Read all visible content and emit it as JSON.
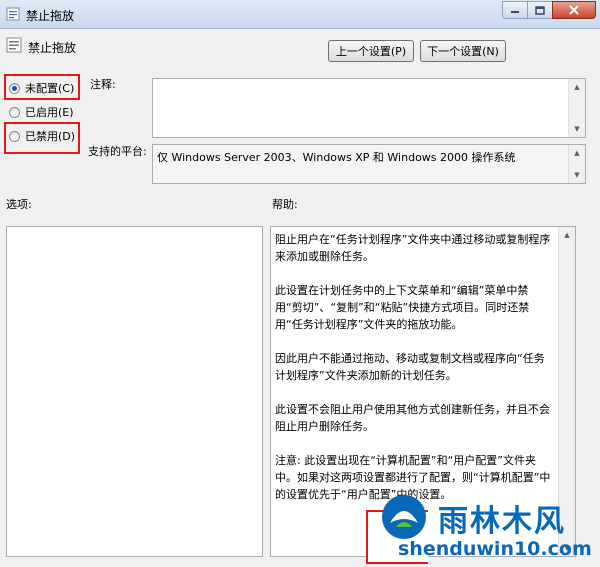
{
  "window": {
    "title": "禁止拖放",
    "controls": [
      "minimize-icon",
      "maximize-icon",
      "close-icon"
    ]
  },
  "header": {
    "policy_name": "禁止拖放",
    "prev_button": "上一个设置(P)",
    "next_button": "下一个设置(N)"
  },
  "state": {
    "options": [
      {
        "label": "未配置(C)",
        "checked": true
      },
      {
        "label": "已启用(E)",
        "checked": false
      },
      {
        "label": "已禁用(D)",
        "checked": false
      }
    ]
  },
  "comment": {
    "label": "注释:",
    "value": ""
  },
  "platform": {
    "label": "支持的平台:",
    "value": "仅 Windows Server 2003、Windows XP 和 Windows 2000 操作系统"
  },
  "options_panel": {
    "label": "选项:"
  },
  "help_panel": {
    "label": "帮助:",
    "paragraphs": [
      "阻止用户在“任务计划程序”文件夹中通过移动或复制程序来添加或删除任务。",
      "此设置在计划任务中的上下文菜单和“编辑”菜单中禁用“剪切”、“复制”和“粘贴”快捷方式项目。同时还禁用“任务计划程序”文件夹的拖放功能。",
      "因此用户不能通过拖动、移动或复制文档或程序向“任务计划程序”文件夹添加新的计划任务。",
      "此设置不会阻止用户使用其他方式创建新任务，并且不会阻止用户删除任务。",
      "注意: 此设置出现在“计算机配置”和“用户配置”文件夹中。如果对这两项设置都进行了配置，则“计算机配置”中的设置优先于“用户配置”中的设置。"
    ]
  },
  "watermark": {
    "name": "雨林木风",
    "url": "shenduwin10.com"
  },
  "colors": {
    "highlight": "#e0191b",
    "watermark": "#0a68b8"
  }
}
